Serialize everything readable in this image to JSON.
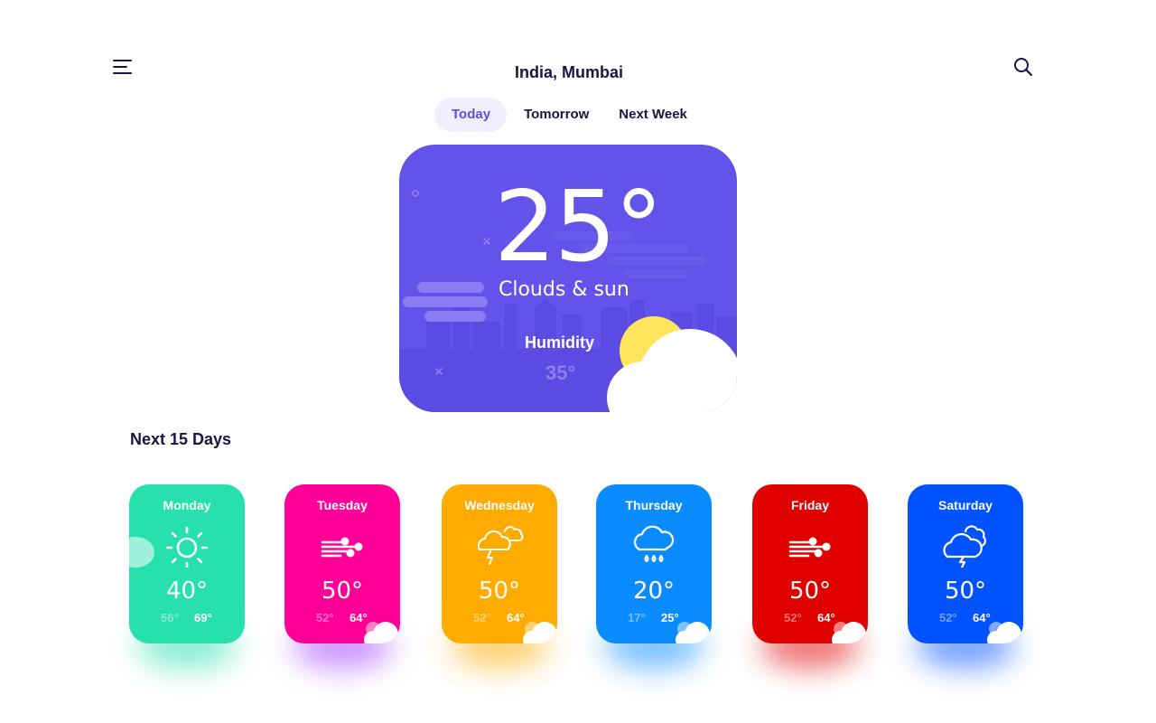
{
  "header": {
    "location": "India, Mumbai",
    "menu_icon": "menu-icon",
    "search_icon": "search-icon"
  },
  "tabs": [
    {
      "label": "Today",
      "active": true
    },
    {
      "label": "Tomorrow",
      "active": false
    },
    {
      "label": "Next Week",
      "active": false
    }
  ],
  "current": {
    "temperature": "25°",
    "condition": "Clouds & sun",
    "humidity_label": "Humidity",
    "humidity_value": "35°",
    "icon": "sun-cloud-icon",
    "background": "#6453ea"
  },
  "forecast": {
    "title": "Next 15 Days",
    "days": [
      {
        "day": "Monday",
        "temp": "40°",
        "low": "56°",
        "high": "69°",
        "icon": "sun-icon",
        "color": "#27e0ae"
      },
      {
        "day": "Tuesday",
        "temp": "50°",
        "low": "52°",
        "high": "64°",
        "icon": "wind-icon",
        "color": "#ff0099"
      },
      {
        "day": "Wednesday",
        "temp": "50°",
        "low": "52°",
        "high": "64°",
        "icon": "storm-cloud-icon",
        "color": "#ffab00"
      },
      {
        "day": "Thursday",
        "temp": "20°",
        "low": "17°",
        "high": "25°",
        "icon": "rain-cloud-icon",
        "color": "#0a8cff"
      },
      {
        "day": "Friday",
        "temp": "50°",
        "low": "52°",
        "high": "64°",
        "icon": "wind-icon",
        "color": "#e00000"
      },
      {
        "day": "Saturday",
        "temp": "50°",
        "low": "52°",
        "high": "64°",
        "icon": "thunder-cloud-icon",
        "color": "#0053ff"
      }
    ]
  }
}
